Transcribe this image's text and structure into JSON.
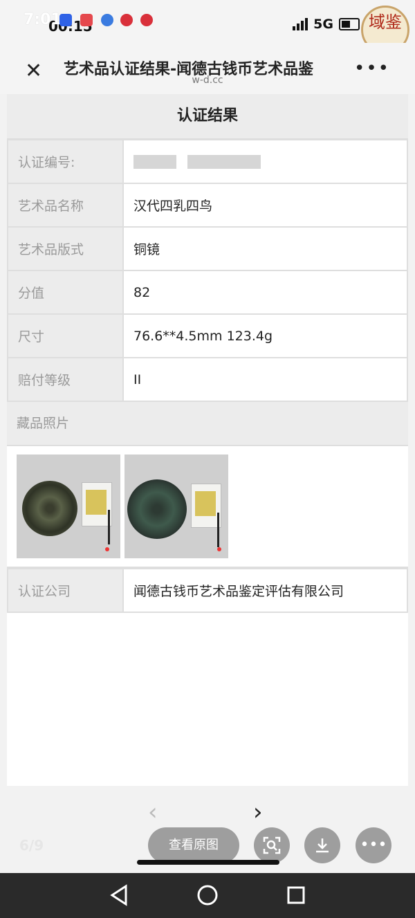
{
  "status_bar": {
    "time_overlay": "7:01",
    "time": "00:15",
    "network": "5G"
  },
  "watermark": {
    "text": "域鉴"
  },
  "header": {
    "title": "艺术品认证结果-闻德古钱币艺术品鉴",
    "domain": "w-d.cc",
    "close_icon": "close-icon",
    "more_icon": "more-icon"
  },
  "result": {
    "title": "认证结果",
    "rows": [
      {
        "label": "认证编号:",
        "value": ""
      },
      {
        "label": "艺术品名称",
        "value": "汉代四乳四鸟"
      },
      {
        "label": "艺术品版式",
        "value": "铜镜"
      },
      {
        "label": "分值",
        "value": "82"
      },
      {
        "label": "尺寸",
        "value": "76.6**4.5mm 123.4g"
      },
      {
        "label": "赔付等级",
        "value": "II"
      }
    ],
    "photos_label": "藏品照片",
    "company_label": "认证公司",
    "company_value": "闻德古钱币艺术品鉴定评估有限公司"
  },
  "viewer": {
    "counter": "6/9",
    "view_original": "查看原图",
    "icons": [
      "prev-arrow-icon",
      "next-arrow-icon",
      "scan-icon",
      "download-icon",
      "more-icon"
    ]
  },
  "colors": {
    "page_bg": "#f2f2f2",
    "label_bg": "#ececec",
    "button_gray": "#9e9e9e"
  }
}
